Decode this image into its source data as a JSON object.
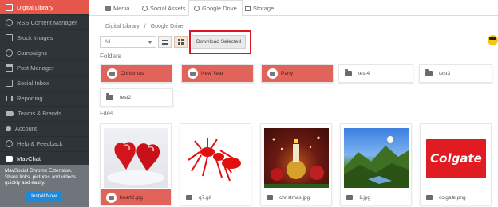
{
  "sidebar": {
    "items": [
      {
        "label": "Digital Library",
        "icon": "image-icon",
        "active": true
      },
      {
        "label": "RSS Content Manager",
        "icon": "rss-icon",
        "active": false
      },
      {
        "label": "Stock Images",
        "icon": "stock-images-icon",
        "active": false
      },
      {
        "label": "Campaigns",
        "icon": "campaigns-icon",
        "active": false
      },
      {
        "label": "Post Manager",
        "icon": "post-manager-icon",
        "active": false
      },
      {
        "label": "Social Inbox",
        "icon": "inbox-icon",
        "active": false
      },
      {
        "label": "Reporting",
        "icon": "reporting-icon",
        "active": false
      },
      {
        "label": "Teams & Brands",
        "icon": "teams-icon",
        "active": false
      },
      {
        "label": "Account",
        "icon": "account-icon",
        "active": false
      },
      {
        "label": "Help & Feedback",
        "icon": "help-icon",
        "active": false
      },
      {
        "label": "MavChat",
        "icon": "chat-icon",
        "active": false
      }
    ],
    "promo_text": "MavSocial Chrome Extension. Share links, pictures and videos quickly and easily.",
    "install_label": "Install Now"
  },
  "tabs": [
    {
      "label": "Media",
      "icon": "camera-icon",
      "active": false
    },
    {
      "label": "Social Assets",
      "icon": "globe-icon",
      "active": false
    },
    {
      "label": "Google Drive",
      "icon": "google-drive-icon",
      "active": true
    },
    {
      "label": "Storage",
      "icon": "storage-icon",
      "active": false
    }
  ],
  "breadcrumb": {
    "root": "Digital Library",
    "separator": "/",
    "current": "Google Drive"
  },
  "toolbar": {
    "filter_value": "All",
    "download_label": "Download Selected"
  },
  "folders_label": "Folders",
  "folders": [
    {
      "name": "Christmas",
      "selected": true
    },
    {
      "name": "New Year",
      "selected": true
    },
    {
      "name": "Party",
      "selected": true
    },
    {
      "name": "test4",
      "selected": false
    },
    {
      "name": "test3",
      "selected": false
    },
    {
      "name": "test2",
      "selected": false
    }
  ],
  "files_label": "Files",
  "files": [
    {
      "name": "heart2.jpg",
      "selected": true
    },
    {
      "name": "q7.gif",
      "selected": false
    },
    {
      "name": "christmas.jpg",
      "selected": false
    },
    {
      "name": "1.jpg",
      "selected": false
    },
    {
      "name": "colgate.png",
      "selected": false
    }
  ],
  "colgate_logo_text": "Colgate",
  "colors": {
    "accent": "#e5574a",
    "sidebar_bg": "#2f3438",
    "highlight": "#e0151f"
  }
}
